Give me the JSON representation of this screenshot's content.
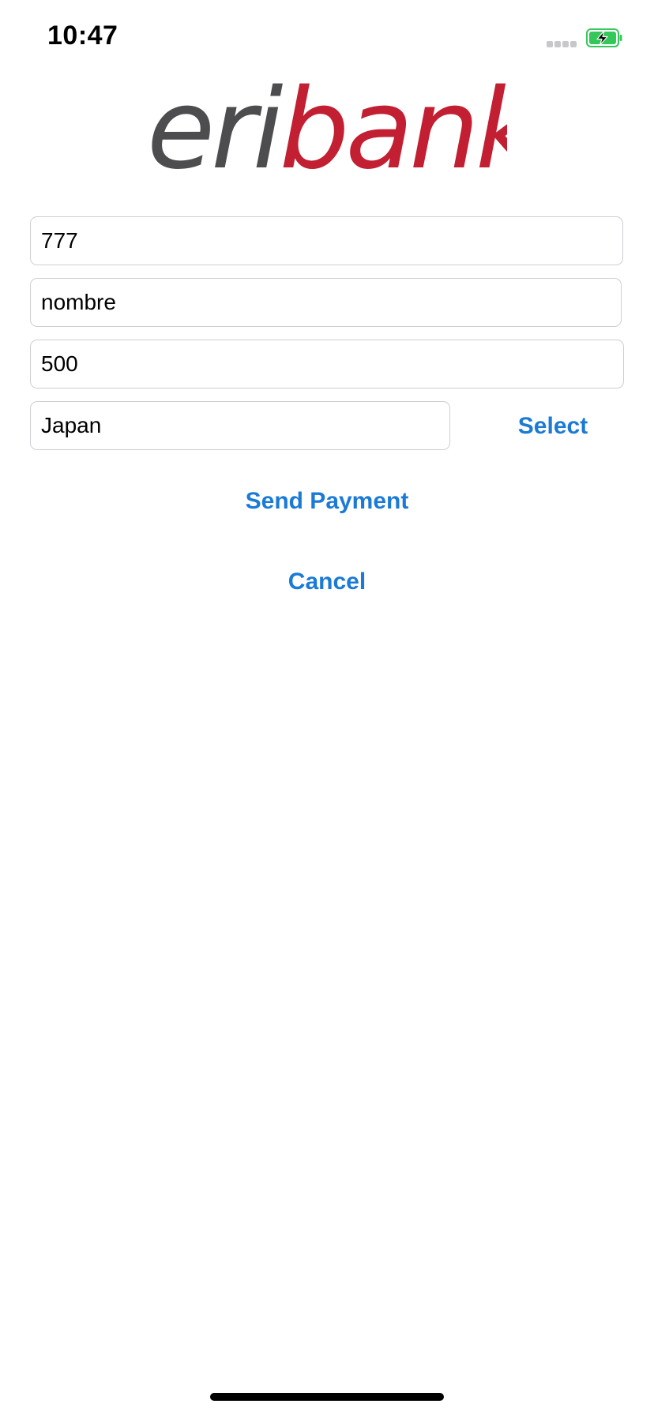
{
  "status_bar": {
    "time": "10:47",
    "battery_state": "charging",
    "battery_color": "#34c759",
    "signal_color": "#c7c7cc"
  },
  "logo": {
    "part1": "eri",
    "part2": "bank",
    "part1_color": "#4d4d4f",
    "part2_color": "#c21f32"
  },
  "form": {
    "account_value": "777",
    "name_value": "nombre",
    "amount_value": "500",
    "country_value": "Japan"
  },
  "buttons": {
    "select_label": "Select",
    "send_label": "Send Payment",
    "cancel_label": "Cancel"
  },
  "colors": {
    "accent": "#1b7ad6",
    "field_border": "#cfcfd4"
  }
}
